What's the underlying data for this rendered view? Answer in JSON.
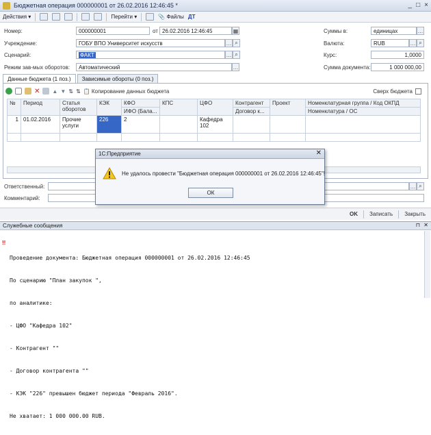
{
  "window": {
    "title": "Бюджетная операция 000000001 от 26.02.2016 12:46:45 *",
    "controls": [
      "_",
      "□",
      "×"
    ]
  },
  "toolbar": {
    "actions_label": "Действия",
    "goto_label": "Перейти",
    "files_label": "Файлы"
  },
  "form": {
    "number_label": "Номер:",
    "number_value": "000000001",
    "date_label": "от",
    "date_value": "26.02.2016 12:46:45",
    "institution_label": "Учреждение:",
    "institution_value": "ГОБУ ВПО Университет искусств",
    "scenario_label": "Сценарий:",
    "scenario_value": "ФАКТ",
    "mode_label": "Режим зав-мых оборотов:",
    "mode_value": "Автоматический",
    "sums_label": "Суммы в:",
    "sums_value": "единицах",
    "currency_label": "Валюта:",
    "currency_value": "RUB",
    "rate_label": "Курс:",
    "rate_value": "1,0000",
    "total_label": "Сумма документа:",
    "total_value": "1 000 000,00",
    "responsible_label": "Ответственный:",
    "comment_label": "Комментарий:"
  },
  "tabs": [
    {
      "label": "Данные бюджета (1 поз.)",
      "active": true
    },
    {
      "label": "Зависимые обороты (0 поз.)",
      "active": false
    }
  ],
  "grid_toolbar": {
    "copy_label": "Копирование данных бюджета",
    "collapse_label": "Сверх бюджета"
  },
  "grid": {
    "headers_top": [
      "№",
      "Период",
      "Статья оборотов",
      "КЭК",
      "КФО",
      "КПС",
      "ЦФО",
      "Контрагент",
      "Проект",
      "Номенклатурная группа / Код ОКПД"
    ],
    "headers_bottom": [
      "ИФО (Бала...",
      "Договор к...",
      "Номенклатура / ОС"
    ],
    "rows": [
      {
        "n": "1",
        "period": "01.02.2016",
        "article": "Прочие услуги",
        "kek": "226",
        "kfo": "2",
        "kps": "",
        "cfo": "Кафедра 102",
        "contragent": "",
        "project": "",
        "nom": ""
      }
    ]
  },
  "dialog": {
    "title": "1С:Предприятие",
    "message": "Не удалось провести \"Бюджетная операция 000000001 от 26.02.2016 12:46:45\"!",
    "ok_label": "ОК"
  },
  "footer": {
    "ok_label": "OK",
    "save_label": "Записать",
    "close_label": "Закрыть"
  },
  "messages": {
    "header": "Служебные сообщения",
    "lines": [
      "Проведение документа: Бюджетная операция 000000001 от 26.02.2016 12:46:45",
      "По сценарию \"План закупок \",",
      "по аналитике:",
      "- ЦФО \"Кафедра 102\"",
      "- Контрагент \"\"",
      "- Договор контрагента \"\"",
      "- КЭК \"226\" превышен бюджет периода \"Февраль 2016\".",
      "Не хватает: 1 000 000.00 RUB."
    ]
  }
}
